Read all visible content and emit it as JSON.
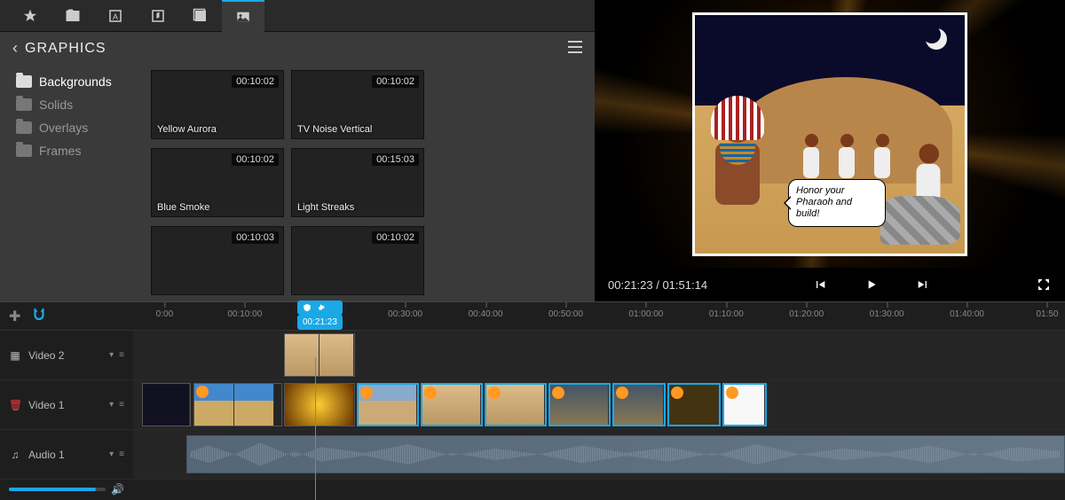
{
  "tabs": [
    "favorites",
    "media",
    "text",
    "audio",
    "effects",
    "graphics"
  ],
  "panel": {
    "title": "GRAPHICS",
    "folders": [
      {
        "label": "Backgrounds",
        "active": true
      },
      {
        "label": "Solids",
        "active": false
      },
      {
        "label": "Overlays",
        "active": false
      },
      {
        "label": "Frames",
        "active": false
      }
    ],
    "thumbs": [
      {
        "name": "Yellow Aurora",
        "dur": "00:10:02",
        "style": "yellow-aurora"
      },
      {
        "name": "TV Noise Vertical",
        "dur": "00:10:02",
        "style": "tv-noise"
      },
      {
        "name": "Blue Smoke",
        "dur": "00:10:02",
        "style": "blue-smoke"
      },
      {
        "name": "Light Streaks",
        "dur": "00:15:03",
        "style": "light-streaks"
      },
      {
        "name": "",
        "dur": "00:10:03",
        "style": "red-particles"
      },
      {
        "name": "",
        "dur": "00:10:02",
        "style": "white-circle"
      }
    ]
  },
  "preview": {
    "current_time": "00:21:23",
    "total_time": "01:51:14",
    "speech_text": "Honor your Pharaoh and build!"
  },
  "timeline": {
    "playhead": "00:21:23",
    "ticks": [
      "0:00",
      "00:10:00",
      "00:20:00",
      "00:30:00",
      "00:40:00",
      "00:50:00",
      "01:00:00",
      "01:10:00",
      "01:20:00",
      "01:30:00",
      "01:40:00",
      "01:50"
    ],
    "tracks": [
      {
        "id": "video2",
        "label": "Video 2",
        "icon": "▦",
        "color": "#bbb"
      },
      {
        "id": "video1",
        "label": "Video 1",
        "icon": "🗑",
        "color": "#c44"
      },
      {
        "id": "audio1",
        "label": "Audio 1",
        "icon": "♫",
        "color": "#bbb"
      }
    ]
  }
}
